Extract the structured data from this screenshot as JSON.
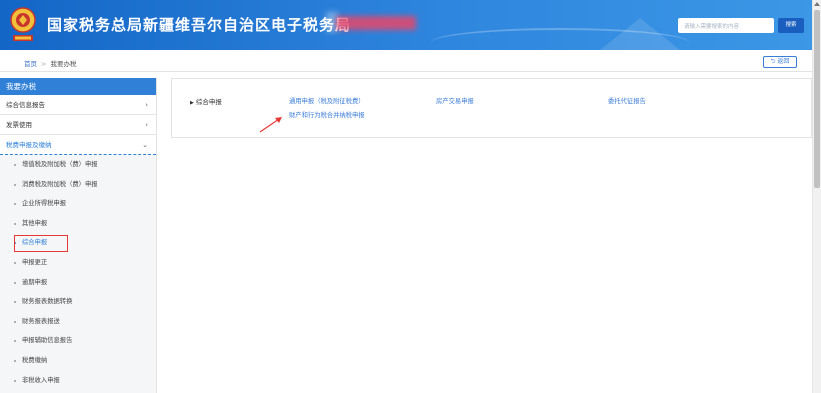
{
  "header": {
    "title": "国家税务总局新疆维吾尔自治区电子税务局",
    "search_placeholder": "请输入需要搜索的内容",
    "search_button": "搜索",
    "emblem_icon": "tax-emblem-icon"
  },
  "breadcrumb": {
    "home": "首页",
    "separator": ">",
    "current": "我要办税",
    "back_label": "返回"
  },
  "sidebar": {
    "header": "我要办税",
    "groups": [
      {
        "label": "综合信息报告",
        "chevron": "›"
      },
      {
        "label": "发票使用",
        "chevron": "›"
      },
      {
        "label": "税费申报及缴纳",
        "chevron": "⌄"
      }
    ],
    "sub_items": [
      "增值税及附加税（费）申报",
      "消费税及附加税（费）申报",
      "企业所得税申报",
      "其他申报",
      "综合申报",
      "申报更正",
      "逾期申报",
      "财务报表数据转换",
      "财务报表报送",
      "申报辅助信息报告",
      "税费缴纳",
      "非税收入申报"
    ],
    "selected_item": "综合申报"
  },
  "content": {
    "category": "综合申报",
    "links": [
      "通用申报（税及附征税费）",
      "房产交易申报",
      "委托代征报告",
      "财产和行为税合并纳税申报"
    ]
  },
  "colors": {
    "header_blue": "#1466c6",
    "sidebar_header": "#2f80d6",
    "link": "#3b7cd6",
    "highlight": "#e53935"
  }
}
